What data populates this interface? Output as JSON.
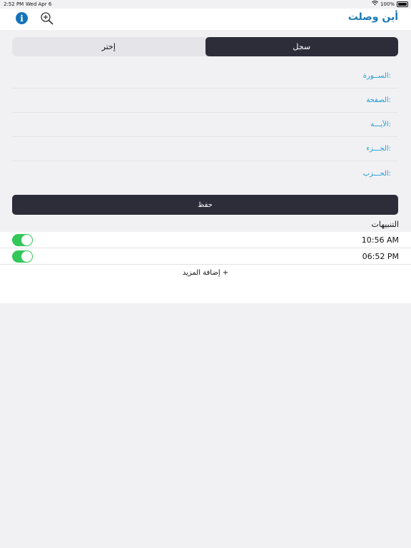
{
  "status_bar": {
    "time": "2:52 PM",
    "date": "Wed Apr 6",
    "battery": "100%"
  },
  "nav": {
    "title": "أين وصلت"
  },
  "segments": {
    "active": "سجل",
    "inactive": "إختر"
  },
  "form": {
    "fields": [
      {
        "label": "الســورة:"
      },
      {
        "label": "الصفحة:"
      },
      {
        "label": "الآيـــة:"
      },
      {
        "label": "الجـــزء:"
      },
      {
        "label": "الحـــزب:"
      }
    ]
  },
  "save_button": {
    "label": "حفظ"
  },
  "alerts": {
    "header": "التنبيهات",
    "items": [
      {
        "time": "10:56 AM",
        "enabled": true
      },
      {
        "time": "06:52 PM",
        "enabled": true
      }
    ],
    "add_more": "إضافة المزيد +"
  },
  "colors": {
    "accent": "#1e9bd3",
    "title": "#1c78b4",
    "dark": "#2c2d39",
    "toggle_on": "#34c759"
  }
}
